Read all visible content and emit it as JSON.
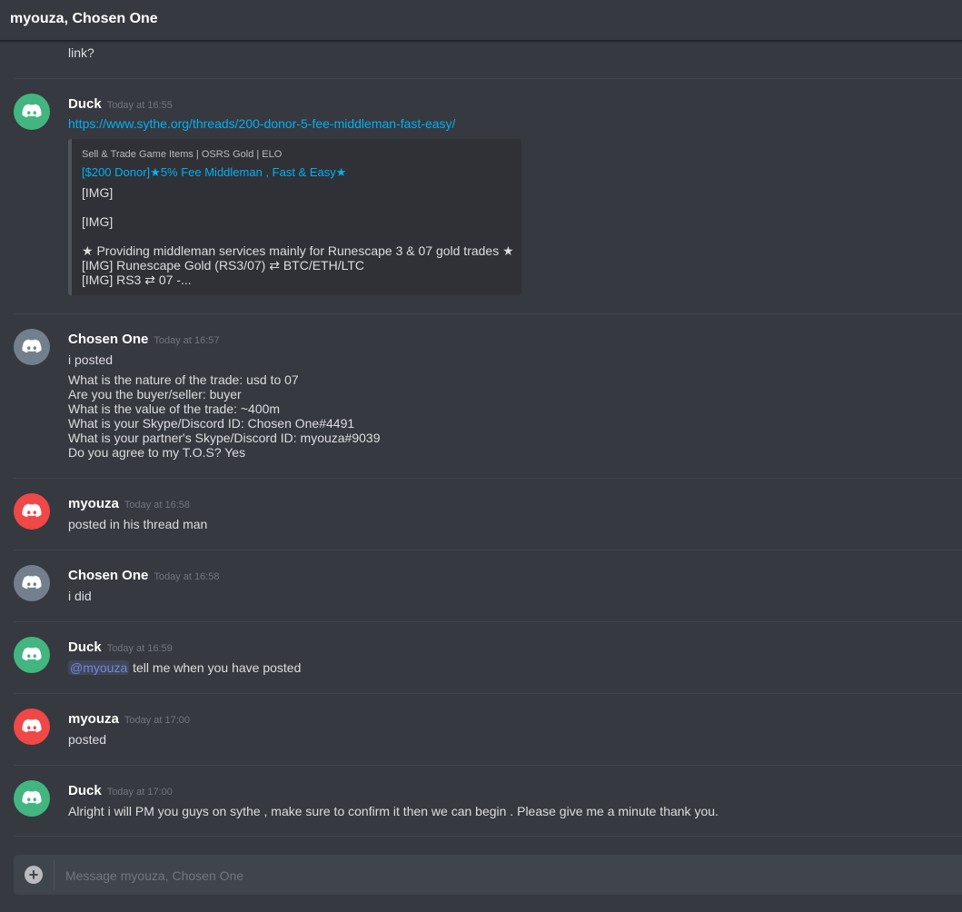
{
  "header": {
    "title": "myouza, Chosen One"
  },
  "top_continuation": "link?",
  "messages": [
    {
      "author": "Duck",
      "timestamp": "Today at 16:55",
      "link": "https://www.sythe.org/threads/200-donor-5-fee-middleman-fast-easy/",
      "embed": {
        "provider": "Sell & Trade Game Items | OSRS Gold | ELO",
        "title": "[$200 Donor]★5% Fee Middleman , Fast & Easy★",
        "lines": [
          "[IMG]",
          "[IMG]",
          "★ Providing middleman services mainly for Runescape 3 & 07 gold trades ★",
          "[IMG] Runescape Gold (RS3/07) ⇄  BTC/ETH/LTC",
          "[IMG] RS3 ⇄ 07 -..."
        ]
      }
    },
    {
      "author": "Chosen One",
      "timestamp": "Today at 16:57",
      "lines": [
        "i posted",
        "What is the nature of the trade: usd to 07",
        "Are you the buyer/seller: buyer",
        "What is the value of the trade: ~400m",
        "What is your Skype/Discord ID: Chosen One#4491",
        "What is your partner's Skype/Discord ID: myouza#9039",
        "Do you agree to my T.O.S? Yes"
      ]
    },
    {
      "author": "myouza",
      "timestamp": "Today at 16:58",
      "text": "posted in his thread man"
    },
    {
      "author": "Chosen One",
      "timestamp": "Today at 16:58",
      "text": "i did"
    },
    {
      "author": "Duck",
      "timestamp": "Today at 16:59",
      "mention": "@myouza",
      "text": " tell me when you have posted"
    },
    {
      "author": "myouza",
      "timestamp": "Today at 17:00",
      "text": "posted"
    },
    {
      "author": "Duck",
      "timestamp": "Today at 17:00",
      "text": "Alright i will PM you guys on sythe , make sure to confirm it then we can begin . Please give me a minute thank you."
    }
  ],
  "composer": {
    "placeholder": "Message myouza, Chosen One"
  },
  "icons": {
    "avatar": "discord-logo-icon",
    "attach": "plus-circle-icon"
  },
  "colors": {
    "background": "#36393f",
    "link": "#00b0f4",
    "avatar_green": "#43b581",
    "avatar_grey": "#747f8d",
    "avatar_red": "#f04747"
  }
}
